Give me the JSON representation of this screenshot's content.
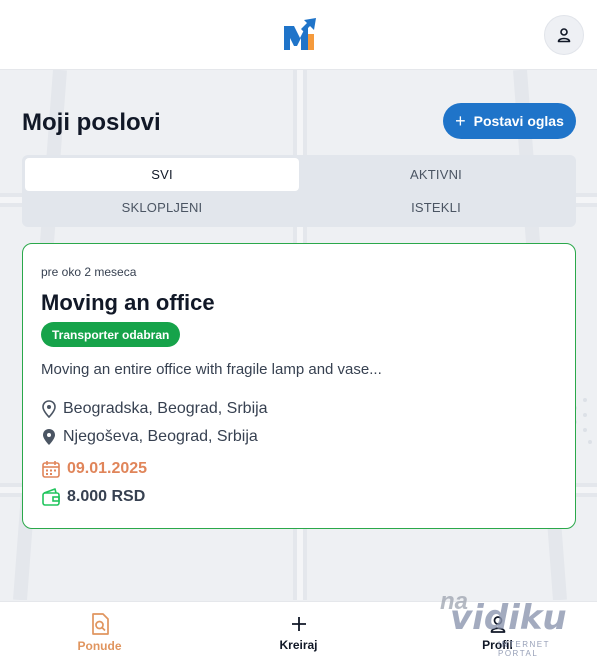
{
  "app": {
    "logo_icon": "m-arrow-logo-icon",
    "profile_icon": "user-icon"
  },
  "header": {
    "title": "Moji poslovi",
    "post_button": "Postavi oglas",
    "post_icon": "plus-icon"
  },
  "tabs": [
    {
      "label": "SVI",
      "active": true
    },
    {
      "label": "AKTIVNI",
      "active": false
    },
    {
      "label": "SKLOPLJENI",
      "active": false
    },
    {
      "label": "ISTEKLI",
      "active": false
    }
  ],
  "job": {
    "posted": "pre oko 2 meseca",
    "title": "Moving an office",
    "status": "Transporter odabran",
    "description": "Moving an entire office with fragile lamp and vase...",
    "from": "Beogradska, Beograd, Srbija",
    "to": "Njegoševa, Beograd, Srbija",
    "date": "09.01.2025",
    "price": "8.000 RSD"
  },
  "nav": [
    {
      "label": "Ponude",
      "icon": "offers-icon",
      "active": true
    },
    {
      "label": "Kreiraj",
      "icon": "plus-icon",
      "active": false
    },
    {
      "label": "Profil",
      "icon": "user-icon",
      "active": false
    }
  ],
  "watermark": {
    "line1": "na",
    "line2": "vidiku",
    "line3": "INTERNET PORTAL"
  },
  "colors": {
    "primary": "#1f74c9",
    "success": "#16a34a",
    "accent": "#e0855a",
    "background": "#eef0f3"
  }
}
